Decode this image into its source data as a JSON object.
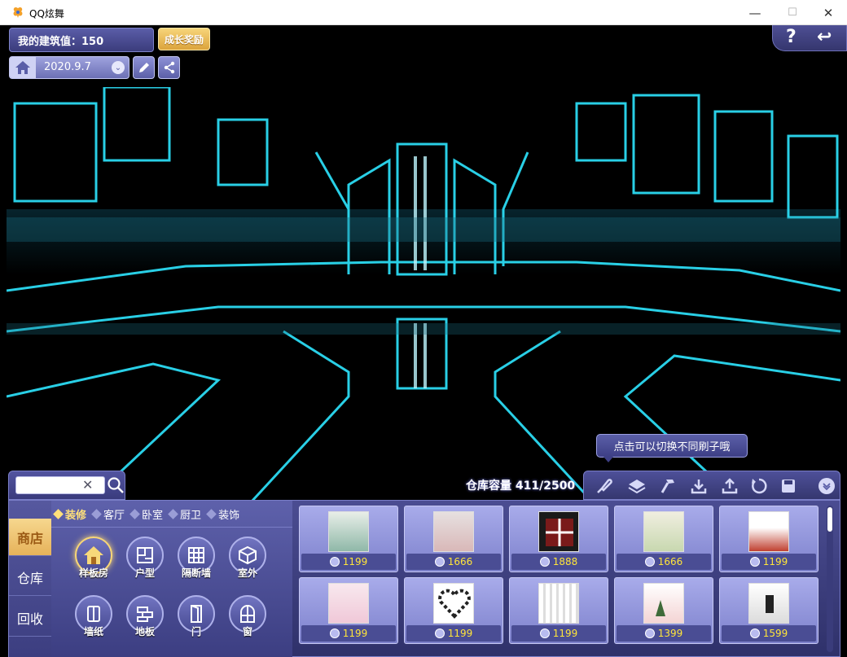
{
  "window": {
    "title": "QQ炫舞",
    "minimize": "—",
    "maximize": "☐",
    "close": "✕"
  },
  "topbar": {
    "build_value": "我的建筑值：150",
    "growth_button": "成长奖励",
    "date": "2020.9.7",
    "help": "?",
    "back": "↩"
  },
  "tooltip": "点击可以切换不同刷子哦",
  "search": {
    "value": "",
    "placeholder": ""
  },
  "storage": "仓库容量 411/2500",
  "side_tabs": [
    "商店",
    "仓库",
    "回收"
  ],
  "subcategories": [
    {
      "label": "装修",
      "active": true
    },
    {
      "label": "客厅",
      "active": false
    },
    {
      "label": "卧室",
      "active": false
    },
    {
      "label": "厨卫",
      "active": false
    },
    {
      "label": "装饰",
      "active": false
    }
  ],
  "categories": [
    {
      "label": "样板房",
      "icon": "house-icon",
      "active": true
    },
    {
      "label": "户型",
      "icon": "floorplan-icon",
      "active": false
    },
    {
      "label": "隔断墙",
      "icon": "grid-wall-icon",
      "active": false
    },
    {
      "label": "室外",
      "icon": "cube-icon",
      "active": false
    },
    {
      "label": "墙纸",
      "icon": "wallpaper-icon",
      "active": false
    },
    {
      "label": "地板",
      "icon": "floor-icon",
      "active": false
    },
    {
      "label": "门",
      "icon": "door-icon",
      "active": false
    },
    {
      "label": "窗",
      "icon": "window-icon",
      "active": false
    }
  ],
  "items": [
    {
      "price": "1199",
      "thumb_color": "#8fb8a8"
    },
    {
      "price": "1666",
      "thumb_color": "#d9b8b8"
    },
    {
      "price": "1888",
      "thumb_color": "#5a2020"
    },
    {
      "price": "1666",
      "thumb_color": "#c8d8b0"
    },
    {
      "price": "1199",
      "thumb_color": "#c04030"
    },
    {
      "price": "1199",
      "thumb_color": "#f0c8d8"
    },
    {
      "price": "1199",
      "thumb_color": "#333333"
    },
    {
      "price": "1199",
      "thumb_color": "#e8e8e8"
    },
    {
      "price": "1399",
      "thumb_color": "#f4d4d4"
    },
    {
      "price": "1599",
      "thumb_color": "#dcdcdc"
    }
  ],
  "toolbar_icons": [
    "brush-icon",
    "layers-icon",
    "hammer-icon",
    "download-icon",
    "upload-icon",
    "rotate-icon",
    "save-icon"
  ],
  "colors": {
    "panel": "#3c3e82",
    "accent": "#ffe07a",
    "price": "#ffe53a",
    "neon": "#2ee6ff"
  }
}
